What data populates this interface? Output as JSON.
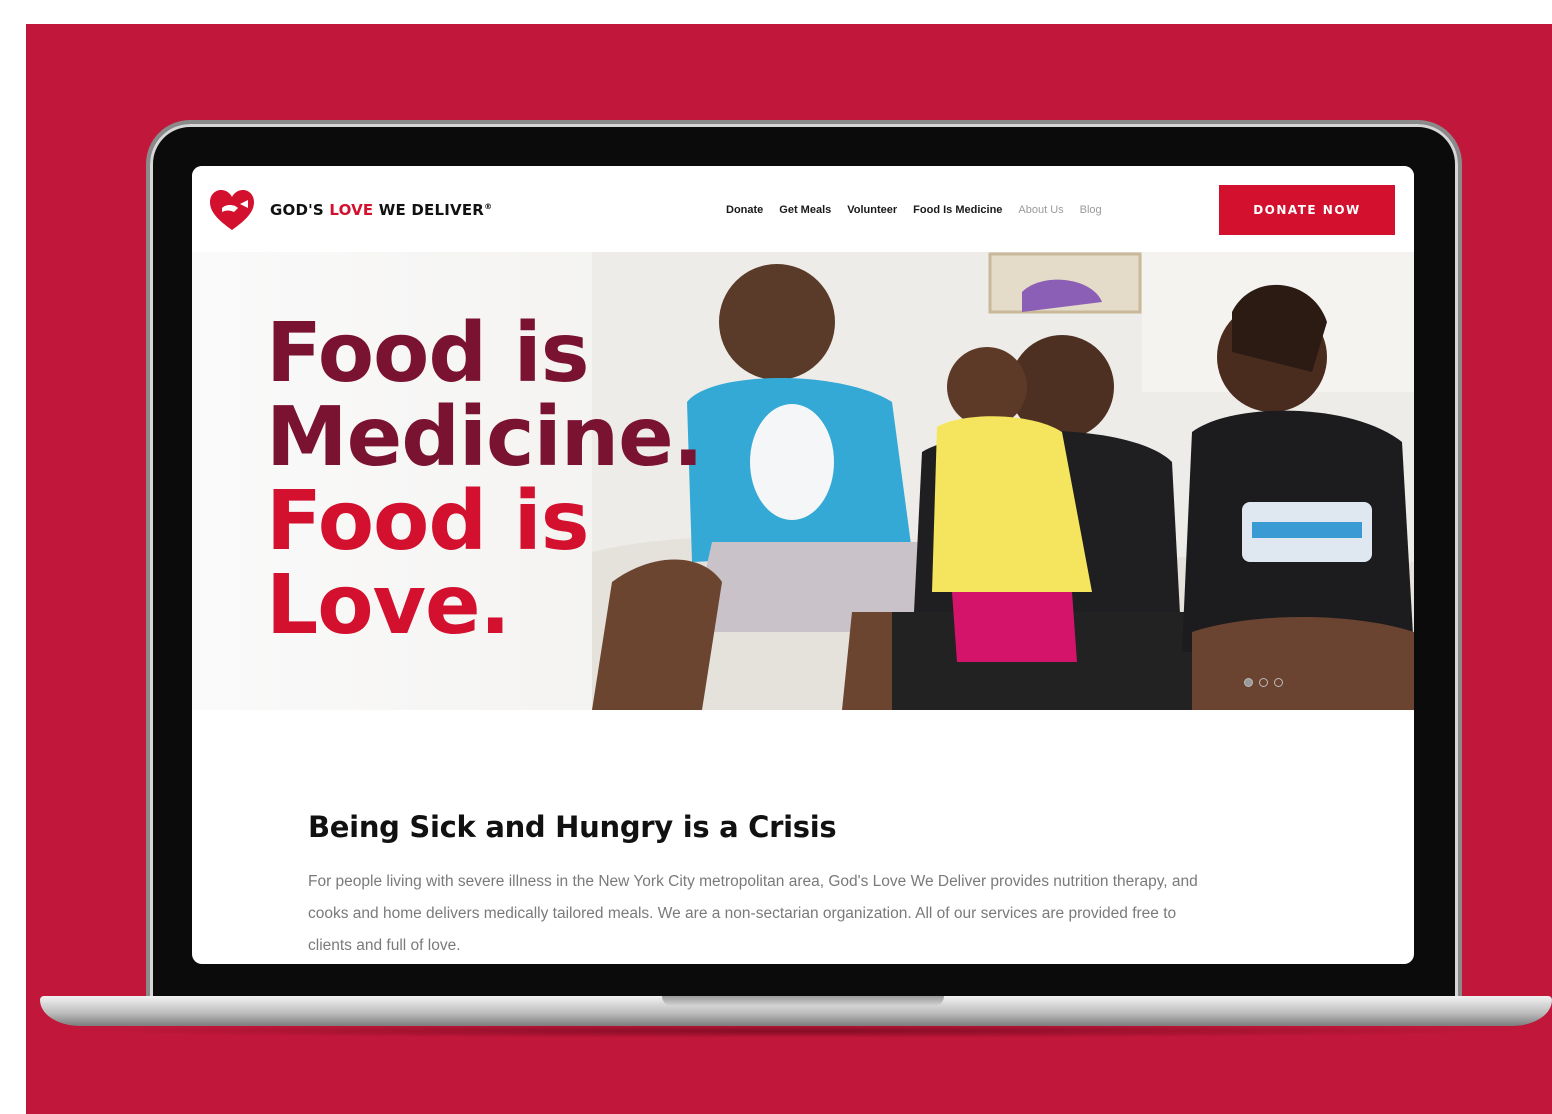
{
  "colors": {
    "backdrop": "#c0173a",
    "brand_red": "#d3102e",
    "headline_maroon": "#7a1232",
    "body_text": "#7a7a7a"
  },
  "header": {
    "logo": {
      "icon": "heart-logo-icon",
      "text_part1": "GOD'S ",
      "text_part2": "LOVE",
      "text_part3": " WE DELIVER",
      "reg_mark": "®"
    },
    "nav": [
      {
        "label": "Donate"
      },
      {
        "label": "Get Meals"
      },
      {
        "label": "Volunteer"
      },
      {
        "label": "Food Is Medicine"
      },
      {
        "label": "About Us"
      },
      {
        "label": "Blog"
      }
    ],
    "cta_label": "DONATE NOW"
  },
  "hero": {
    "headline_line1": "Food is",
    "headline_line2": "Medicine.",
    "headline_line3": "Food is",
    "headline_line4": "Love.",
    "carousel_dots": 3,
    "active_dot": 1
  },
  "intro": {
    "heading": "Being Sick and Hungry is a Crisis",
    "body": "For people living with severe illness in the New York City metropolitan area, God's Love We Deliver provides nutrition therapy, and cooks and home delivers medically tailored meals. We are a non-sectarian organization. All of our services are provided free to clients and full of love."
  }
}
